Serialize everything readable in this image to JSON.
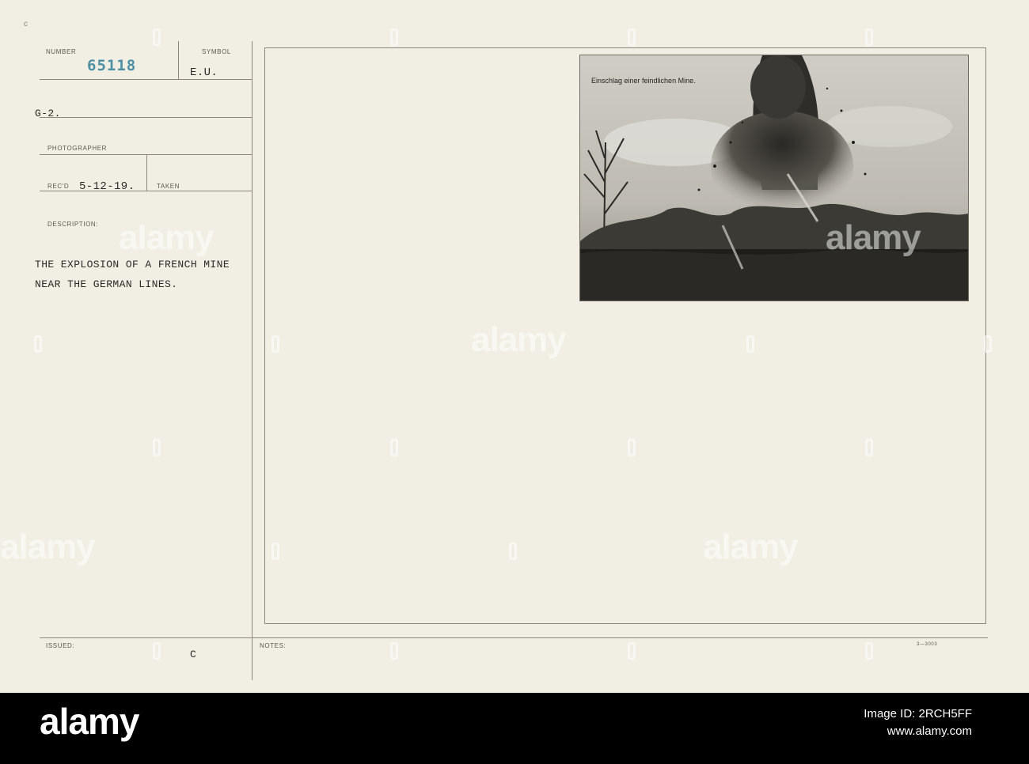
{
  "card": {
    "corner_mark": "c",
    "number_label": "NUMBER",
    "number_value": "65118",
    "symbol_label": "SYMBOL",
    "symbol_value": "E.U.",
    "source_value": "G-2.",
    "photographer_label": "PHOTOGRAPHER",
    "recd_label": "REC'D",
    "recd_value": "5-12-19.",
    "taken_label": "TAKEN",
    "description_label": "DESCRIPTION:",
    "description_line1": "THE EXPLOSION OF A FRENCH MINE",
    "description_line2": "NEAR THE GERMAN LINES.",
    "issued_label": "ISSUED:",
    "issued_mark": "C",
    "notes_label": "NOTES:",
    "form_number": "3—3003"
  },
  "photo": {
    "caption": "Einschlag einer feindlichen Mine."
  },
  "watermark": {
    "text": "alamy"
  },
  "footer": {
    "logo": "alamy",
    "image_id_label": "Image ID: 2RCH5FF",
    "url": "www.alamy.com"
  }
}
